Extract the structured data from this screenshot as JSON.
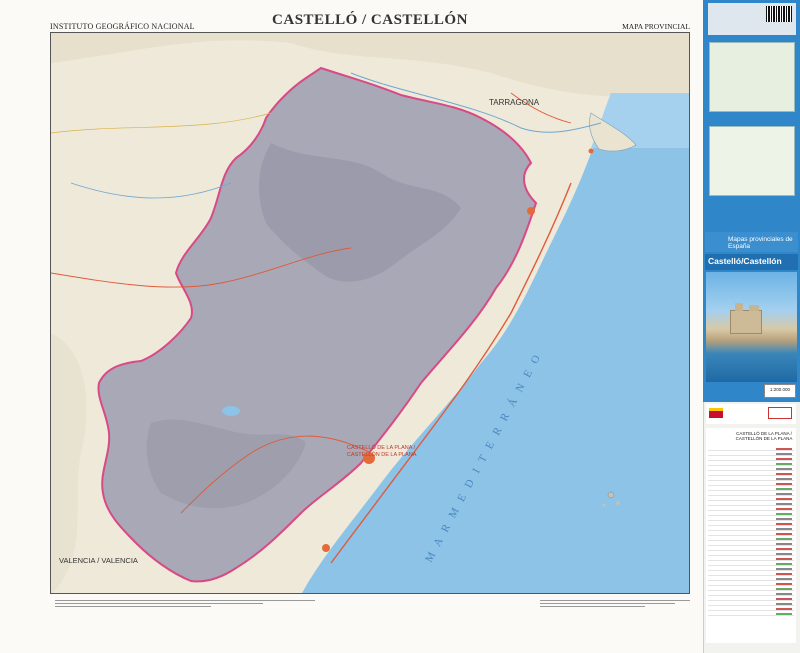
{
  "header": {
    "publisher": "INSTITUTO GEOGRÁFICO NACIONAL",
    "title": "CASTELLÓ / CASTELLÓN",
    "series": "MAPA PROVINCIAL"
  },
  "map": {
    "sea_name": "M A R   M E D I T E R R Á N E O",
    "place_labels": {
      "tarragona": "TARRAGONA",
      "valencia": "VALENCIA / VALENCIA",
      "capital_line1": "CASTELLÓ DE LA PLANA /",
      "capital_line2": "CASTELLÓN DE LA PLANA"
    },
    "colors": {
      "sea": "#8cc3e6",
      "province": "#a8a8b6",
      "province_border": "#d84a86",
      "land": "#efe9da",
      "roads": "#e05a3a",
      "urban": "#e36b3a"
    }
  },
  "panel": {
    "brand": "Mapas provinciales de España",
    "title": "Castelló/Castellón",
    "scale": "1:200.000",
    "legend_title_1": "CASTELLÓ DE LA PLANA /",
    "legend_title_2": "CASTELLÓN DE LA PLANA"
  }
}
